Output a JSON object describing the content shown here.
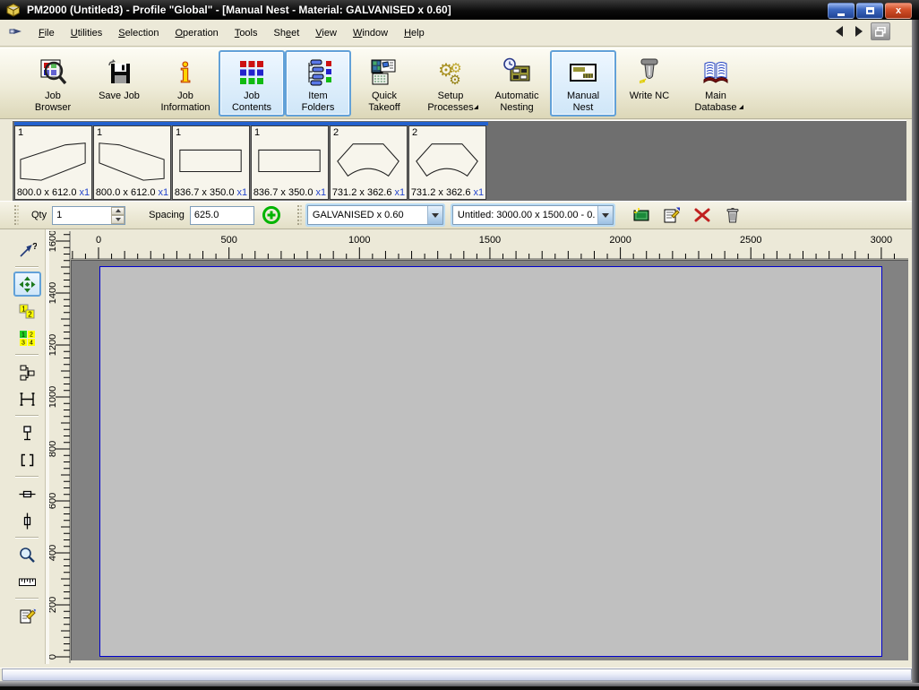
{
  "window": {
    "title": "PM2000 (Untitled3) - Profile \"Global\" - [Manual Nest  - Material: GALVANISED x 0.60]",
    "app_icon": "pm2000-app-icon",
    "controls": [
      "minimize",
      "maximize",
      "close"
    ]
  },
  "menu": {
    "system_icon": "pointing-hand-icon",
    "items": [
      {
        "label": "File",
        "underline": 0
      },
      {
        "label": "Utilities",
        "underline": 0
      },
      {
        "label": "Selection",
        "underline": 0
      },
      {
        "label": "Operation",
        "underline": 0
      },
      {
        "label": "Tools",
        "underline": 0
      },
      {
        "label": "Sheet",
        "underline": 2
      },
      {
        "label": "View",
        "underline": 0
      },
      {
        "label": "Window",
        "underline": 0
      },
      {
        "label": "Help",
        "underline": 0
      }
    ],
    "nav": {
      "back_icon": "nav-back-icon",
      "forward_icon": "nav-forward-icon",
      "restore_icon": "restore-window-icon"
    }
  },
  "toolbar": {
    "buttons": [
      {
        "id": "job-browser",
        "lines": [
          "Job",
          "Browser"
        ],
        "icon": "job-browser-icon",
        "selected": false,
        "dropdown": false
      },
      {
        "id": "save-job",
        "lines": [
          "Save Job"
        ],
        "icon": "save-job-icon",
        "selected": false,
        "dropdown": false
      },
      {
        "id": "job-information",
        "lines": [
          "Job",
          "Information"
        ],
        "icon": "job-information-icon",
        "selected": false,
        "dropdown": false
      },
      {
        "id": "job-contents",
        "lines": [
          "Job",
          "Contents"
        ],
        "icon": "job-contents-icon",
        "selected": true,
        "dropdown": false
      },
      {
        "id": "item-folders",
        "lines": [
          "Item",
          "Folders"
        ],
        "icon": "item-folders-icon",
        "selected": true,
        "dropdown": false
      },
      {
        "id": "quick-takeoff",
        "lines": [
          "Quick",
          "Takeoff"
        ],
        "icon": "quick-takeoff-icon",
        "selected": false,
        "dropdown": false
      },
      {
        "id": "setup-processes",
        "lines": [
          "Setup",
          "Processes"
        ],
        "icon": "setup-processes-icon",
        "selected": false,
        "dropdown": true
      },
      {
        "id": "automatic-nesting",
        "lines": [
          "Automatic",
          "Nesting"
        ],
        "icon": "automatic-nesting-icon",
        "selected": false,
        "dropdown": false
      },
      {
        "id": "manual-nest",
        "lines": [
          "Manual",
          "Nest"
        ],
        "icon": "manual-nest-icon",
        "selected": true,
        "dropdown": false
      },
      {
        "id": "write-nc",
        "lines": [
          "Write NC"
        ],
        "icon": "write-nc-icon",
        "selected": false,
        "dropdown": false
      },
      {
        "id": "main-database",
        "lines": [
          "Main",
          "Database"
        ],
        "icon": "main-database-icon",
        "selected": false,
        "dropdown": true
      }
    ]
  },
  "parts": [
    {
      "number": "1",
      "size": "800.0 x 612.0",
      "qty": "x1",
      "shape": "transition-up"
    },
    {
      "number": "1",
      "size": "800.0 x 612.0",
      "qty": "x1",
      "shape": "transition-down"
    },
    {
      "number": "1",
      "size": "836.7 x 350.0",
      "qty": "x1",
      "shape": "rectangle"
    },
    {
      "number": "1",
      "size": "836.7 x 350.0",
      "qty": "x1",
      "shape": "rectangle"
    },
    {
      "number": "2",
      "size": "731.2 x 362.6",
      "qty": "x1",
      "shape": "hopper"
    },
    {
      "number": "2",
      "size": "731.2 x 362.6",
      "qty": "x1",
      "shape": "hopper"
    }
  ],
  "controls": {
    "qty_label": "Qty",
    "qty_value": "1",
    "spacing_label": "Spacing",
    "spacing_value": "625.0",
    "add_icon": "add-green-plus-icon",
    "material_combo": {
      "value": "GALVANISED x 0.60"
    },
    "sheet_combo": {
      "value": "Untitled: 3000.00 x 1500.00 - 0."
    },
    "sheet_buttons": [
      {
        "id": "new-sheet",
        "icon": "new-sheet-icon"
      },
      {
        "id": "sheet-properties",
        "icon": "sheet-properties-icon"
      },
      {
        "id": "delete-nest",
        "icon": "delete-red-x-icon"
      },
      {
        "id": "delete-sheet",
        "icon": "trash-icon"
      }
    ]
  },
  "left_toolbar": {
    "buttons": [
      {
        "id": "query-item",
        "icon": "pointer-query-icon",
        "selected": false
      },
      {
        "id": "move-item",
        "icon": "move-arrows-icon",
        "selected": true
      },
      {
        "id": "renumber-parts",
        "icon": "renumber-12-icon",
        "selected": false
      },
      {
        "id": "renumber-all",
        "icon": "renumber-1234-icon",
        "selected": false
      },
      {
        "id": "hierarchy",
        "icon": "hierarchy-icon",
        "selected": false
      },
      {
        "id": "align-h",
        "icon": "h-frame-icon",
        "selected": false
      },
      {
        "id": "pin-part",
        "icon": "pin-icon",
        "selected": false
      },
      {
        "id": "select-region",
        "icon": "selection-brackets-icon",
        "selected": false
      },
      {
        "id": "extent-horizontal",
        "icon": "horizontal-extent-icon",
        "selected": false
      },
      {
        "id": "extent-vertical",
        "icon": "vertical-extent-icon",
        "selected": false
      },
      {
        "id": "zoom-tool",
        "icon": "zoom-icon",
        "selected": false
      },
      {
        "id": "measure-tool",
        "icon": "measure-ruler-icon",
        "selected": false
      },
      {
        "id": "item-properties",
        "icon": "item-properties-icon",
        "selected": false
      }
    ],
    "separators_after": [
      0,
      3,
      5,
      7,
      9,
      11
    ]
  },
  "rulers": {
    "horizontal": {
      "labels": [
        0,
        500,
        1000,
        1500,
        2000,
        2500,
        3000
      ],
      "minor_step": 50,
      "unit_max": 3000
    },
    "vertical": {
      "labels": [
        0,
        200,
        400,
        600,
        800,
        1000,
        1200,
        1400,
        1600
      ],
      "minor_step": 25,
      "unit_max": 1600
    }
  },
  "canvas": {
    "sheet": {
      "width_units": 3000,
      "height_units": 1500,
      "border_color": "#0000cc",
      "fill_color": "#c0c0c0"
    },
    "background_color": "#828282"
  },
  "colors": {
    "selected_border": "#62a1d8",
    "selected_fill": "#d8ebfa",
    "qty_blue": "#2244cc",
    "titlebar": "#000000",
    "toolbar_cream": "#ece9d8"
  }
}
